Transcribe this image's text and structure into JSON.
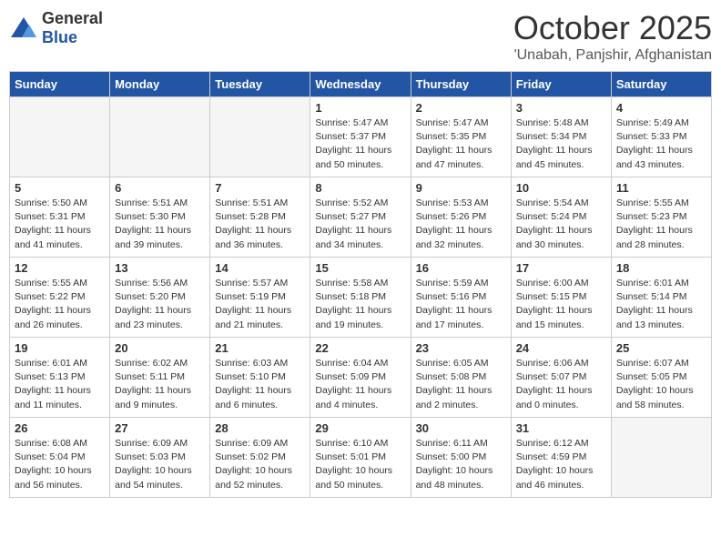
{
  "header": {
    "logo_general": "General",
    "logo_blue": "Blue",
    "month": "October 2025",
    "location": "'Unabah, Panjshir, Afghanistan"
  },
  "days_of_week": [
    "Sunday",
    "Monday",
    "Tuesday",
    "Wednesday",
    "Thursday",
    "Friday",
    "Saturday"
  ],
  "weeks": [
    [
      {
        "day": "",
        "sunrise": "",
        "sunset": "",
        "daylight": "",
        "empty": true
      },
      {
        "day": "",
        "sunrise": "",
        "sunset": "",
        "daylight": "",
        "empty": true
      },
      {
        "day": "",
        "sunrise": "",
        "sunset": "",
        "daylight": "",
        "empty": true
      },
      {
        "day": "1",
        "sunrise": "Sunrise: 5:47 AM",
        "sunset": "Sunset: 5:37 PM",
        "daylight": "Daylight: 11 hours and 50 minutes."
      },
      {
        "day": "2",
        "sunrise": "Sunrise: 5:47 AM",
        "sunset": "Sunset: 5:35 PM",
        "daylight": "Daylight: 11 hours and 47 minutes."
      },
      {
        "day": "3",
        "sunrise": "Sunrise: 5:48 AM",
        "sunset": "Sunset: 5:34 PM",
        "daylight": "Daylight: 11 hours and 45 minutes."
      },
      {
        "day": "4",
        "sunrise": "Sunrise: 5:49 AM",
        "sunset": "Sunset: 5:33 PM",
        "daylight": "Daylight: 11 hours and 43 minutes."
      }
    ],
    [
      {
        "day": "5",
        "sunrise": "Sunrise: 5:50 AM",
        "sunset": "Sunset: 5:31 PM",
        "daylight": "Daylight: 11 hours and 41 minutes."
      },
      {
        "day": "6",
        "sunrise": "Sunrise: 5:51 AM",
        "sunset": "Sunset: 5:30 PM",
        "daylight": "Daylight: 11 hours and 39 minutes."
      },
      {
        "day": "7",
        "sunrise": "Sunrise: 5:51 AM",
        "sunset": "Sunset: 5:28 PM",
        "daylight": "Daylight: 11 hours and 36 minutes."
      },
      {
        "day": "8",
        "sunrise": "Sunrise: 5:52 AM",
        "sunset": "Sunset: 5:27 PM",
        "daylight": "Daylight: 11 hours and 34 minutes."
      },
      {
        "day": "9",
        "sunrise": "Sunrise: 5:53 AM",
        "sunset": "Sunset: 5:26 PM",
        "daylight": "Daylight: 11 hours and 32 minutes."
      },
      {
        "day": "10",
        "sunrise": "Sunrise: 5:54 AM",
        "sunset": "Sunset: 5:24 PM",
        "daylight": "Daylight: 11 hours and 30 minutes."
      },
      {
        "day": "11",
        "sunrise": "Sunrise: 5:55 AM",
        "sunset": "Sunset: 5:23 PM",
        "daylight": "Daylight: 11 hours and 28 minutes."
      }
    ],
    [
      {
        "day": "12",
        "sunrise": "Sunrise: 5:55 AM",
        "sunset": "Sunset: 5:22 PM",
        "daylight": "Daylight: 11 hours and 26 minutes."
      },
      {
        "day": "13",
        "sunrise": "Sunrise: 5:56 AM",
        "sunset": "Sunset: 5:20 PM",
        "daylight": "Daylight: 11 hours and 23 minutes."
      },
      {
        "day": "14",
        "sunrise": "Sunrise: 5:57 AM",
        "sunset": "Sunset: 5:19 PM",
        "daylight": "Daylight: 11 hours and 21 minutes."
      },
      {
        "day": "15",
        "sunrise": "Sunrise: 5:58 AM",
        "sunset": "Sunset: 5:18 PM",
        "daylight": "Daylight: 11 hours and 19 minutes."
      },
      {
        "day": "16",
        "sunrise": "Sunrise: 5:59 AM",
        "sunset": "Sunset: 5:16 PM",
        "daylight": "Daylight: 11 hours and 17 minutes."
      },
      {
        "day": "17",
        "sunrise": "Sunrise: 6:00 AM",
        "sunset": "Sunset: 5:15 PM",
        "daylight": "Daylight: 11 hours and 15 minutes."
      },
      {
        "day": "18",
        "sunrise": "Sunrise: 6:01 AM",
        "sunset": "Sunset: 5:14 PM",
        "daylight": "Daylight: 11 hours and 13 minutes."
      }
    ],
    [
      {
        "day": "19",
        "sunrise": "Sunrise: 6:01 AM",
        "sunset": "Sunset: 5:13 PM",
        "daylight": "Daylight: 11 hours and 11 minutes."
      },
      {
        "day": "20",
        "sunrise": "Sunrise: 6:02 AM",
        "sunset": "Sunset: 5:11 PM",
        "daylight": "Daylight: 11 hours and 9 minutes."
      },
      {
        "day": "21",
        "sunrise": "Sunrise: 6:03 AM",
        "sunset": "Sunset: 5:10 PM",
        "daylight": "Daylight: 11 hours and 6 minutes."
      },
      {
        "day": "22",
        "sunrise": "Sunrise: 6:04 AM",
        "sunset": "Sunset: 5:09 PM",
        "daylight": "Daylight: 11 hours and 4 minutes."
      },
      {
        "day": "23",
        "sunrise": "Sunrise: 6:05 AM",
        "sunset": "Sunset: 5:08 PM",
        "daylight": "Daylight: 11 hours and 2 minutes."
      },
      {
        "day": "24",
        "sunrise": "Sunrise: 6:06 AM",
        "sunset": "Sunset: 5:07 PM",
        "daylight": "Daylight: 11 hours and 0 minutes."
      },
      {
        "day": "25",
        "sunrise": "Sunrise: 6:07 AM",
        "sunset": "Sunset: 5:05 PM",
        "daylight": "Daylight: 10 hours and 58 minutes."
      }
    ],
    [
      {
        "day": "26",
        "sunrise": "Sunrise: 6:08 AM",
        "sunset": "Sunset: 5:04 PM",
        "daylight": "Daylight: 10 hours and 56 minutes."
      },
      {
        "day": "27",
        "sunrise": "Sunrise: 6:09 AM",
        "sunset": "Sunset: 5:03 PM",
        "daylight": "Daylight: 10 hours and 54 minutes."
      },
      {
        "day": "28",
        "sunrise": "Sunrise: 6:09 AM",
        "sunset": "Sunset: 5:02 PM",
        "daylight": "Daylight: 10 hours and 52 minutes."
      },
      {
        "day": "29",
        "sunrise": "Sunrise: 6:10 AM",
        "sunset": "Sunset: 5:01 PM",
        "daylight": "Daylight: 10 hours and 50 minutes."
      },
      {
        "day": "30",
        "sunrise": "Sunrise: 6:11 AM",
        "sunset": "Sunset: 5:00 PM",
        "daylight": "Daylight: 10 hours and 48 minutes."
      },
      {
        "day": "31",
        "sunrise": "Sunrise: 6:12 AM",
        "sunset": "Sunset: 4:59 PM",
        "daylight": "Daylight: 10 hours and 46 minutes."
      },
      {
        "day": "",
        "sunrise": "",
        "sunset": "",
        "daylight": "",
        "empty": true
      }
    ]
  ]
}
